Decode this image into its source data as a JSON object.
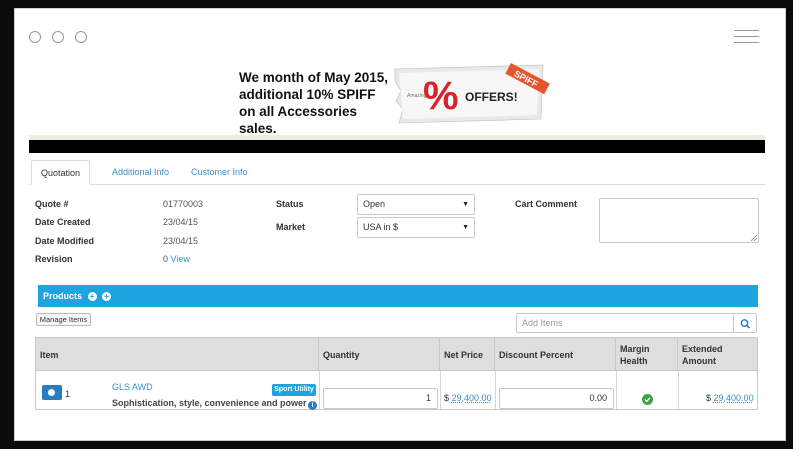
{
  "window": {
    "controls": [
      "dot",
      "dot",
      "dot"
    ],
    "menu_icon": "hamburger-icon"
  },
  "promo": {
    "lines": [
      "We month of May 2015,",
      "additional 10% SPIFF",
      "on all Accessories sales."
    ],
    "offer_image": {
      "percent": "%",
      "text": "OFFERS!",
      "ribbon": "SPIFF",
      "small_text": "Amazing"
    }
  },
  "tabs": [
    "Quotation",
    "Additional Info",
    "Customer Info"
  ],
  "details": {
    "quote_label": "Quote #",
    "quote_value": "01770003",
    "created_label": "Date Created",
    "created_value": "23/04/15",
    "modified_label": "Date Modified",
    "modified_value": "23/04/15",
    "revision_label": "Revision",
    "revision_value": "0",
    "revision_link": "View",
    "status_label": "Status",
    "status_value": "Open",
    "market_label": "Market",
    "market_value": "USA in $",
    "cart_comment_label": "Cart Comment"
  },
  "products": {
    "title": "Products",
    "manage_button": "Manage Items",
    "add_items_placeholder": "Add Items",
    "columns": [
      "Item",
      "Quantity",
      "Net Price",
      "Discount Percent",
      "Margin Health",
      "Extended Amount"
    ],
    "rows": [
      {
        "index": "1",
        "name": "GLS AWD",
        "badge": "Sport Utility",
        "description": "Sophistication, style, convenience and power",
        "quantity": "1",
        "currency": "$",
        "net_price": "29,400.00",
        "discount": "0.00",
        "margin_health": "good",
        "extended_amount": "29,400.00"
      }
    ]
  },
  "colors": {
    "accent": "#1ea4de",
    "link": "#3a8fc9",
    "health_good": "#3fa142"
  }
}
